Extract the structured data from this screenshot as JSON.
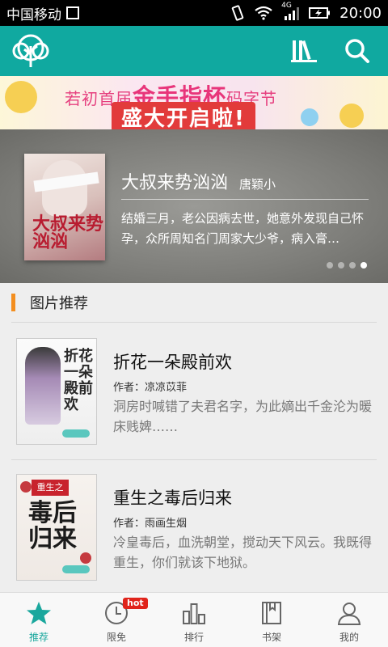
{
  "status_bar": {
    "carrier": "中国移动",
    "network": "4G",
    "time": "20:00"
  },
  "header": {
    "logo_icon": "tree-logo-icon",
    "library_icon": "bookshelf-icon",
    "search_icon": "search-icon"
  },
  "banner": {
    "line1_prefix": "若初首届",
    "line1_highlight": "金手指杯",
    "line1_suffix": "码字节",
    "line2": "盛大开启啦!"
  },
  "featured": {
    "title": "大叔来势汹汹",
    "author": "唐颖小",
    "description": "结婚三月，老公因病去世，她意外发现自己怀孕，众所周知名门周家大少爷，病入膏…",
    "cover_text": "大叔来势汹汹",
    "dots_total": 4,
    "dots_active_index": 3
  },
  "section": {
    "title": "图片推荐"
  },
  "books": [
    {
      "name": "折花一朵殿前欢",
      "author": "作者：凉凉苡菲",
      "intro": "洞房时喊错了夫君名字，为此嫡出千金沦为暖床贱婢……",
      "cover_text": "折花一朵殿前欢"
    },
    {
      "name": "重生之毒后归来",
      "author": "作者：雨画生烟",
      "intro": "冷皇毒后，血洗朝堂，搅动天下风云。我既得重生，你们就该下地狱。",
      "cover_text": "毒后归来",
      "cover_top": "重生之"
    }
  ],
  "bottom_nav": {
    "items": [
      {
        "label": "推荐",
        "icon": "star-icon",
        "active": true
      },
      {
        "label": "限免",
        "icon": "clock-icon",
        "badge": "hot"
      },
      {
        "label": "排行",
        "icon": "bar-chart-icon"
      },
      {
        "label": "书架",
        "icon": "book-icon"
      },
      {
        "label": "我的",
        "icon": "user-icon"
      }
    ]
  },
  "colors": {
    "brand": "#10a9a0",
    "accent_orange": "#f38e1f",
    "nav_active": "#1aa79d",
    "hot_badge": "#e0241b"
  }
}
